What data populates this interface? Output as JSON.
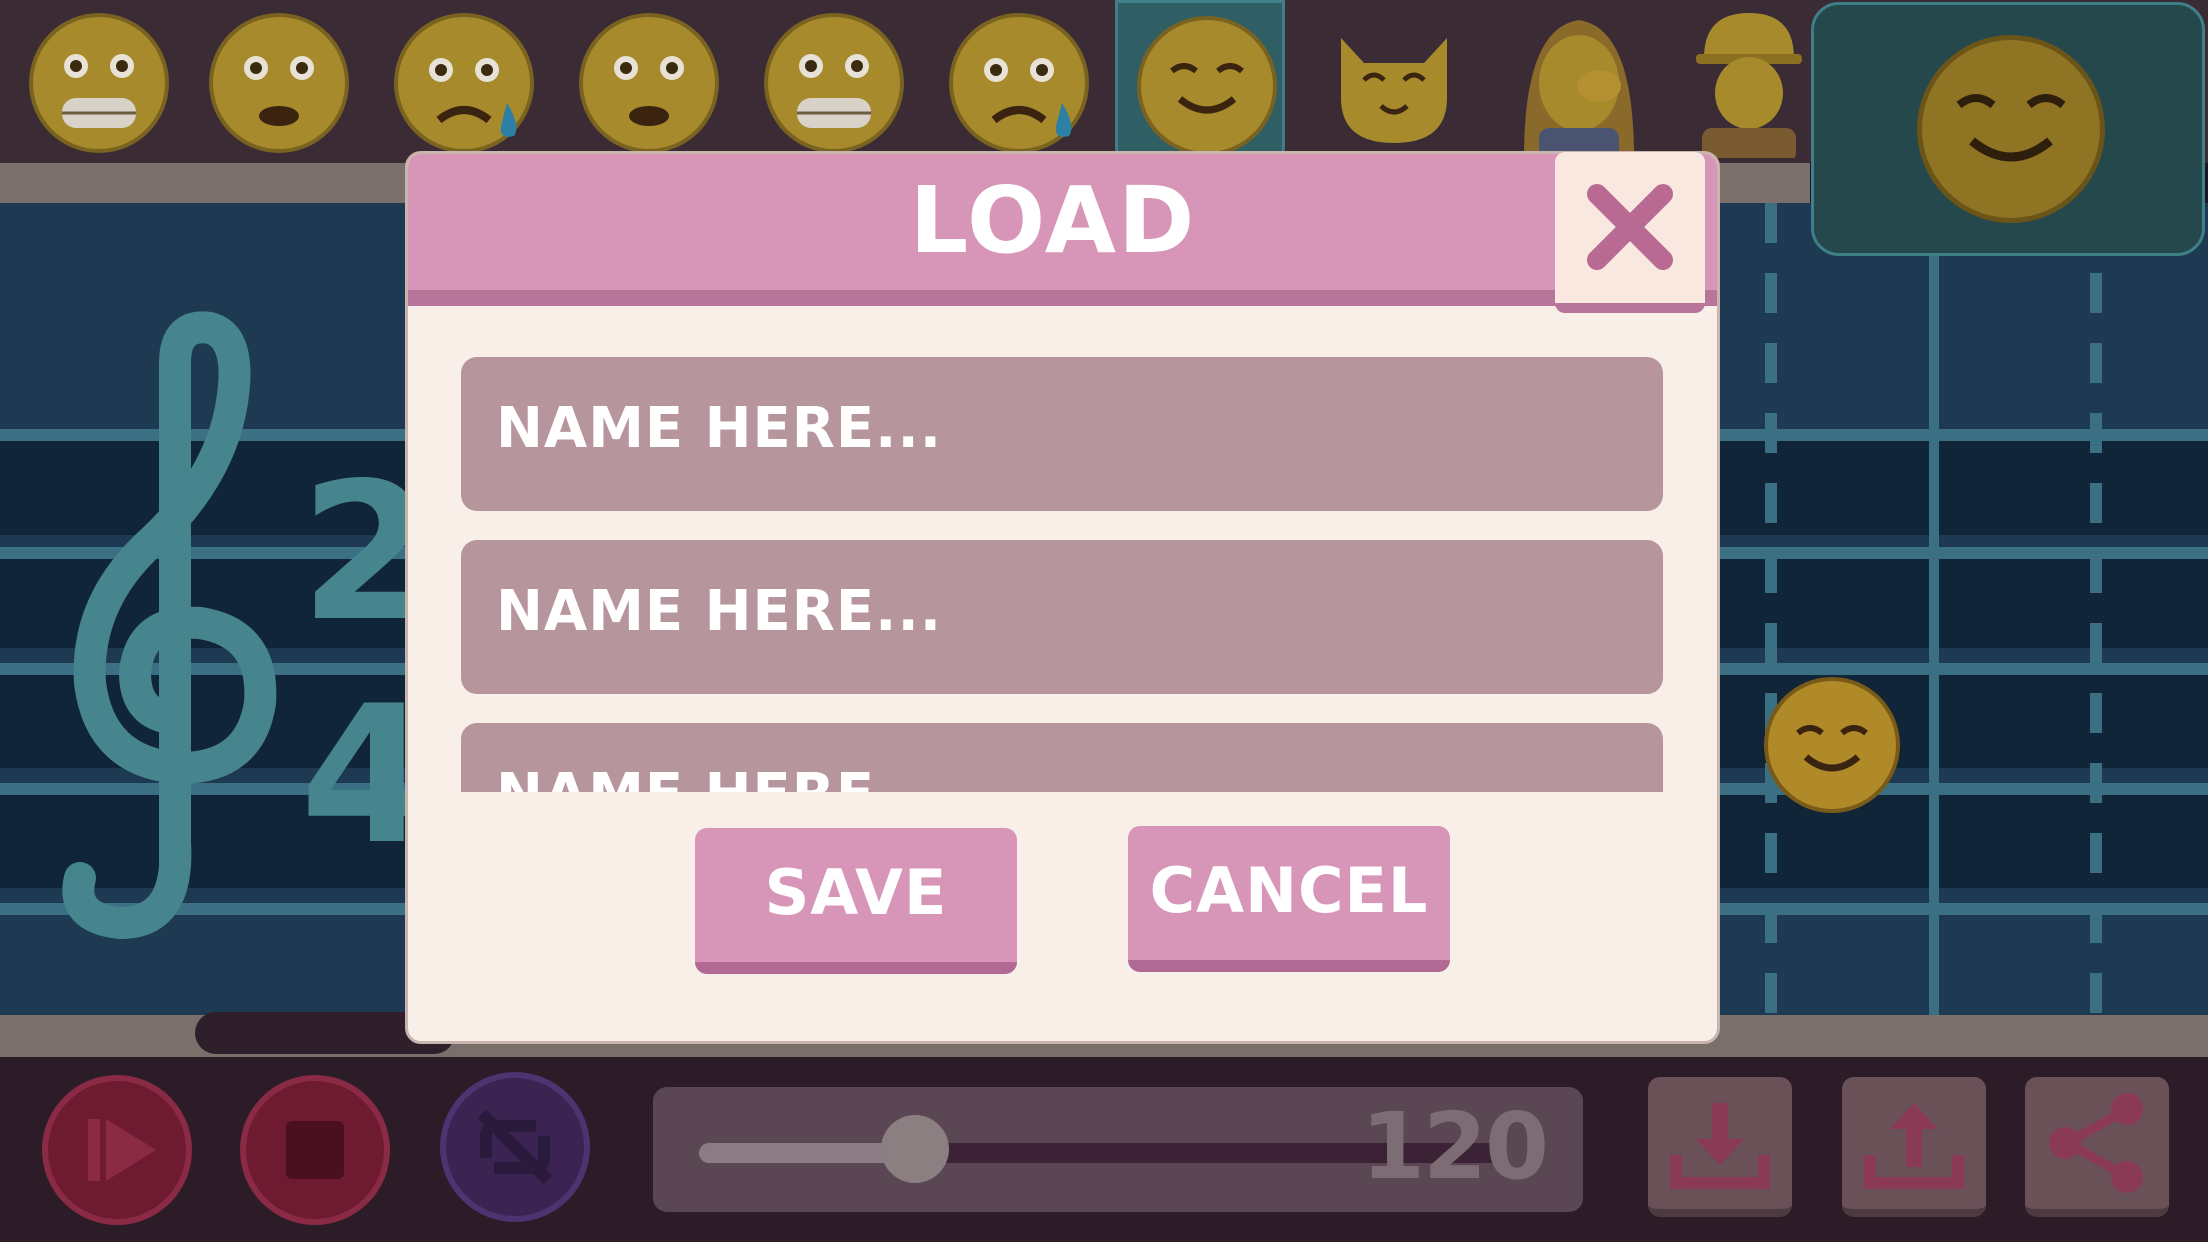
{
  "palette": {
    "emojis": [
      {
        "icon": "grimacing-face-icon"
      },
      {
        "icon": "frowning-face-icon"
      },
      {
        "icon": "sad-sweat-face-icon"
      },
      {
        "icon": "frowning-face-icon"
      },
      {
        "icon": "grimacing-face-icon"
      },
      {
        "icon": "sad-sweat-face-icon"
      },
      {
        "icon": "smiling-relieved-face-icon",
        "selected": true
      },
      {
        "icon": "cat-face-icon"
      },
      {
        "icon": "face-palm-woman-icon"
      },
      {
        "icon": "construction-worker-icon"
      }
    ],
    "preview_icon": "smiling-relieved-face-icon"
  },
  "staff": {
    "clef": "treble-clef",
    "time_signature": {
      "top": "2",
      "bottom": "4"
    }
  },
  "dialog": {
    "title": "LOAD",
    "close_icon": "close-icon",
    "slots": [
      "NAME HERE...",
      "NAME HERE...",
      "NAME HERE..."
    ],
    "save_label": "SAVE",
    "cancel_label": "CANCEL"
  },
  "toolbar": {
    "tempo": "120",
    "buttons": [
      "play-icon",
      "stop-icon",
      "loop-off-icon",
      "download-icon",
      "upload-icon",
      "share-icon"
    ]
  },
  "colors": {
    "dialog_header": "#d795b8",
    "dialog_body": "#f8efe9",
    "slot_fill": "#b7959c",
    "button_pink": "#d795b8",
    "staff_bg": "#1e3a52"
  }
}
